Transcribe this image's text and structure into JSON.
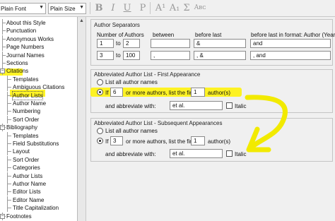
{
  "toolbar": {
    "font_select": "Plain Font",
    "size_select": "Plain Size",
    "bold": "B",
    "italic": "I",
    "underline": "U",
    "plain": "P",
    "superscript": "A¹",
    "subscript": "A₁",
    "symbol": "Σ",
    "smallcaps": "Aʙᴄ"
  },
  "tree": [
    {
      "label": "About this Style",
      "level": 0
    },
    {
      "label": "Punctuation",
      "level": 0
    },
    {
      "label": "Anonymous Works",
      "level": 0
    },
    {
      "label": "Page Numbers",
      "level": 0
    },
    {
      "label": "Journal Names",
      "level": 0
    },
    {
      "label": "Sections",
      "level": 0
    },
    {
      "label": "Citations",
      "level": 0,
      "expanded": true
    },
    {
      "label": "Templates",
      "level": 1
    },
    {
      "label": "Ambiguous Citations",
      "level": 1
    },
    {
      "label": "Author Lists",
      "level": 1,
      "selected": true
    },
    {
      "label": "Author Name",
      "level": 1
    },
    {
      "label": "Numbering",
      "level": 1
    },
    {
      "label": "Sort Order",
      "level": 1
    },
    {
      "label": "Bibliography",
      "level": 0,
      "expanded": true
    },
    {
      "label": "Templates",
      "level": 1
    },
    {
      "label": "Field Substitutions",
      "level": 1
    },
    {
      "label": "Layout",
      "level": 1
    },
    {
      "label": "Sort Order",
      "level": 1
    },
    {
      "label": "Categories",
      "level": 1
    },
    {
      "label": "Author Lists",
      "level": 1
    },
    {
      "label": "Author Name",
      "level": 1
    },
    {
      "label": "Editor Lists",
      "level": 1
    },
    {
      "label": "Editor Name",
      "level": 1
    },
    {
      "label": "Title Capitalization",
      "level": 1
    },
    {
      "label": "Footnotes",
      "level": 0,
      "expanded": true
    }
  ],
  "separators": {
    "title": "Author Separators",
    "col_number": "Number of Authors",
    "col_between": "between",
    "col_before_last": "before last",
    "col_before_last_format": "before last in format: Author (Year)",
    "rows": [
      {
        "from": "1",
        "to_label": "to",
        "to": "2",
        "between": "",
        "before_last": "&",
        "before_last_format": "and"
      },
      {
        "from": "3",
        "to_label": "to",
        "to": "100",
        "between": ",",
        "before_last": ", &",
        "before_last_format": ", and"
      }
    ]
  },
  "first_appearance": {
    "title": "Abbreviated Author List - First Appearance",
    "list_all": "List all author names",
    "if_label": "If",
    "count": "6",
    "more_label": "or more authors, list the first",
    "first": "1",
    "authors_label": "author(s)",
    "abbrev_label": "and abbreviate with:",
    "abbrev": "et al.",
    "italic": "Italic"
  },
  "subsequent": {
    "title": "Abbreviated Author List - Subsequent Appearances",
    "list_all": "List all author names",
    "if_label": "If",
    "count": "3",
    "more_label": "or more authors, list the first",
    "first": "1",
    "authors_label": "author(s)",
    "abbrev_label": "and abbreviate with:",
    "abbrev": "et al.",
    "italic": "Italic"
  },
  "colors": {
    "highlight": "#fff200",
    "annotation": "#f2ea00"
  }
}
